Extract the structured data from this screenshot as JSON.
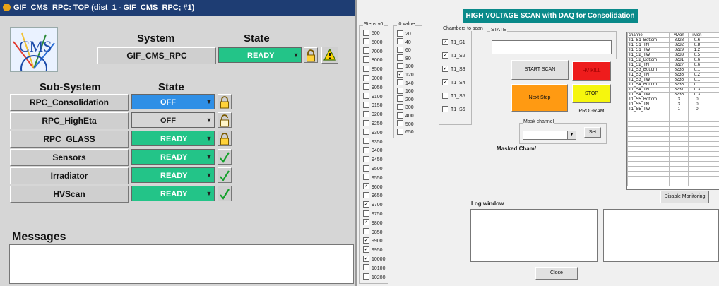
{
  "fsm": {
    "window_title": "GIF_CMS_RPC: TOP (dist_1 - GIF_CMS_RPC; #1)",
    "logo_text": "CMS",
    "col_system": "System",
    "col_state": "State",
    "system": {
      "name": "GIF_CMS_RPC",
      "state": "READY",
      "state_color": "#23c488"
    },
    "col_subsystem": "Sub-System",
    "col_substate": "State",
    "subsystems": [
      {
        "name": "RPC_Consolidation",
        "state": "OFF",
        "color": "#2f8fe6",
        "control": "lock-closed-icon"
      },
      {
        "name": "RPC_HighEta",
        "state": "OFF",
        "color": "#d6d6d6",
        "control": "lock-open-icon"
      },
      {
        "name": "RPC_GLASS",
        "state": "READY",
        "color": "#23c488",
        "control": "lock-closed-icon"
      },
      {
        "name": "Sensors",
        "state": "READY",
        "color": "#23c488",
        "control": "check-icon"
      },
      {
        "name": "Irradiator",
        "state": "READY",
        "color": "#23c488",
        "control": "check-icon"
      },
      {
        "name": "HVScan",
        "state": "READY",
        "color": "#23c488",
        "control": "check-icon"
      }
    ],
    "messages_label": "Messages"
  },
  "hv": {
    "banner": "HIGH VOLTAGE SCAN  with DAQ for Consolidation",
    "steps_label": "Steps v0",
    "steps": [
      {
        "v": "500",
        "c": false
      },
      {
        "v": "5000",
        "c": false
      },
      {
        "v": "7000",
        "c": false
      },
      {
        "v": "8000",
        "c": false
      },
      {
        "v": "8500",
        "c": false
      },
      {
        "v": "9000",
        "c": false
      },
      {
        "v": "9050",
        "c": false
      },
      {
        "v": "9100",
        "c": false
      },
      {
        "v": "9150",
        "c": false
      },
      {
        "v": "9200",
        "c": false
      },
      {
        "v": "9250",
        "c": false
      },
      {
        "v": "9300",
        "c": false
      },
      {
        "v": "9350",
        "c": false
      },
      {
        "v": "9400",
        "c": false
      },
      {
        "v": "9450",
        "c": false
      },
      {
        "v": "9500",
        "c": false
      },
      {
        "v": "9550",
        "c": false
      },
      {
        "v": "9600",
        "c": true
      },
      {
        "v": "9650",
        "c": false
      },
      {
        "v": "9700",
        "c": true
      },
      {
        "v": "9750",
        "c": false
      },
      {
        "v": "9800",
        "c": true
      },
      {
        "v": "9850",
        "c": false
      },
      {
        "v": "9900",
        "c": true
      },
      {
        "v": "9950",
        "c": true
      },
      {
        "v": "10000",
        "c": true
      },
      {
        "v": "10100",
        "c": false
      },
      {
        "v": "10200",
        "c": false
      }
    ],
    "i0_label": "i0 value",
    "i0": [
      {
        "v": "20",
        "c": false
      },
      {
        "v": "40",
        "c": false
      },
      {
        "v": "60",
        "c": false
      },
      {
        "v": "80",
        "c": false
      },
      {
        "v": "100",
        "c": false
      },
      {
        "v": "120",
        "c": true
      },
      {
        "v": "140",
        "c": false
      },
      {
        "v": "160",
        "c": false
      },
      {
        "v": "200",
        "c": false
      },
      {
        "v": "300",
        "c": false
      },
      {
        "v": "400",
        "c": false
      },
      {
        "v": "500",
        "c": false
      },
      {
        "v": "650",
        "c": false
      }
    ],
    "chambers_label": "Chambers to scan",
    "chambers": [
      {
        "v": "T1_S1",
        "c": true
      },
      {
        "v": "T1_S2",
        "c": true
      },
      {
        "v": "T1_S3",
        "c": true
      },
      {
        "v": "T1_S4",
        "c": true
      },
      {
        "v": "T1_S5",
        "c": false
      },
      {
        "v": "T1_S6",
        "c": false
      }
    ],
    "state_label": "STATE",
    "state_value": "",
    "btn_start": "START SCAN",
    "btn_hvkill": "HV KILL",
    "btn_next": "Next Step",
    "btn_stop": "STOP PROGRAM",
    "btn_start_color": "#e1e1e1",
    "btn_hvkill_color": "#ee1c1c",
    "btn_next_color": "#ff9a12",
    "btn_stop_color": "#f6f60d",
    "mask_label": "Mask channel",
    "mask_value": "",
    "btn_set": "Set",
    "masked_label": "Masked Cham/",
    "table": {
      "headers": [
        "channel",
        "vMon",
        "iMon"
      ],
      "rows": [
        [
          "T1_S1_Bottom",
          "8228",
          "0.6"
        ],
        [
          "T1_S1_TN",
          "8232",
          "0.8"
        ],
        [
          "T1_S1_TW",
          "8229",
          "1.2"
        ],
        [
          "T1_S2_TW",
          "8233",
          "0.5"
        ],
        [
          "T1_S2_Bottom",
          "8231",
          "0.6"
        ],
        [
          "T1_S2_TN",
          "8227",
          "0.6"
        ],
        [
          "T1_S3_Bottom",
          "8236",
          "0.1"
        ],
        [
          "T1_S3_TN",
          "8236",
          "0.2"
        ],
        [
          "T1_S3_TW",
          "8236",
          "0.1"
        ],
        [
          "T1_S4_Bottom",
          "8236",
          "0.1"
        ],
        [
          "T1_S4_TN",
          "8237",
          "0.3"
        ],
        [
          "T1_S4_TW",
          "8236",
          "0.3"
        ],
        [
          "T1_S5_Bottom",
          "3",
          "0"
        ],
        [
          "T1_S5_TN",
          "3",
          "0"
        ],
        [
          "T1_S5_TW",
          "1",
          "0"
        ]
      ],
      "empty_rows": 15
    },
    "btn_disable_monitoring": "Disable Monitoring",
    "log_label": "Log window",
    "btn_close": "Close"
  }
}
